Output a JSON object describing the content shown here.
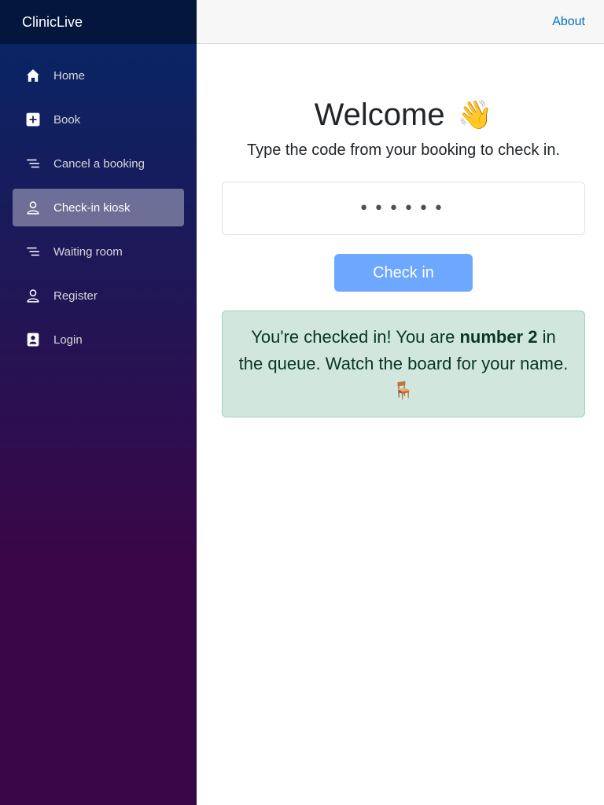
{
  "app": {
    "brand": "ClinicLive"
  },
  "top_row": {
    "about_label": "About"
  },
  "sidebar": {
    "items": [
      {
        "label": "Home",
        "icon": "home-icon"
      },
      {
        "label": "Book",
        "icon": "plus-square-icon"
      },
      {
        "label": "Cancel a booking",
        "icon": "list-icon"
      },
      {
        "label": "Check-in kiosk",
        "icon": "person-icon",
        "active": true
      },
      {
        "label": "Waiting room",
        "icon": "list-icon"
      },
      {
        "label": "Register",
        "icon": "person-icon"
      },
      {
        "label": "Login",
        "icon": "id-badge-icon"
      }
    ]
  },
  "main": {
    "title": "Welcome",
    "title_emoji": "👋",
    "subtitle": "Type the code from your booking to check in.",
    "code_input": {
      "value": "••••••",
      "type": "password"
    },
    "checkin_button": "Check in",
    "alert": {
      "prefix": "You're checked in! You are ",
      "emphasis": "number 2",
      "suffix": " in the queue. Watch the board for your name.",
      "emoji": "🪑"
    }
  },
  "colors": {
    "sidebar_top": "#052767",
    "sidebar_bottom": "#3a0647",
    "accent_link": "#0071c1",
    "button": "#6ea8fe",
    "alert_bg": "#d1e7dd",
    "alert_text": "#0a3622"
  }
}
